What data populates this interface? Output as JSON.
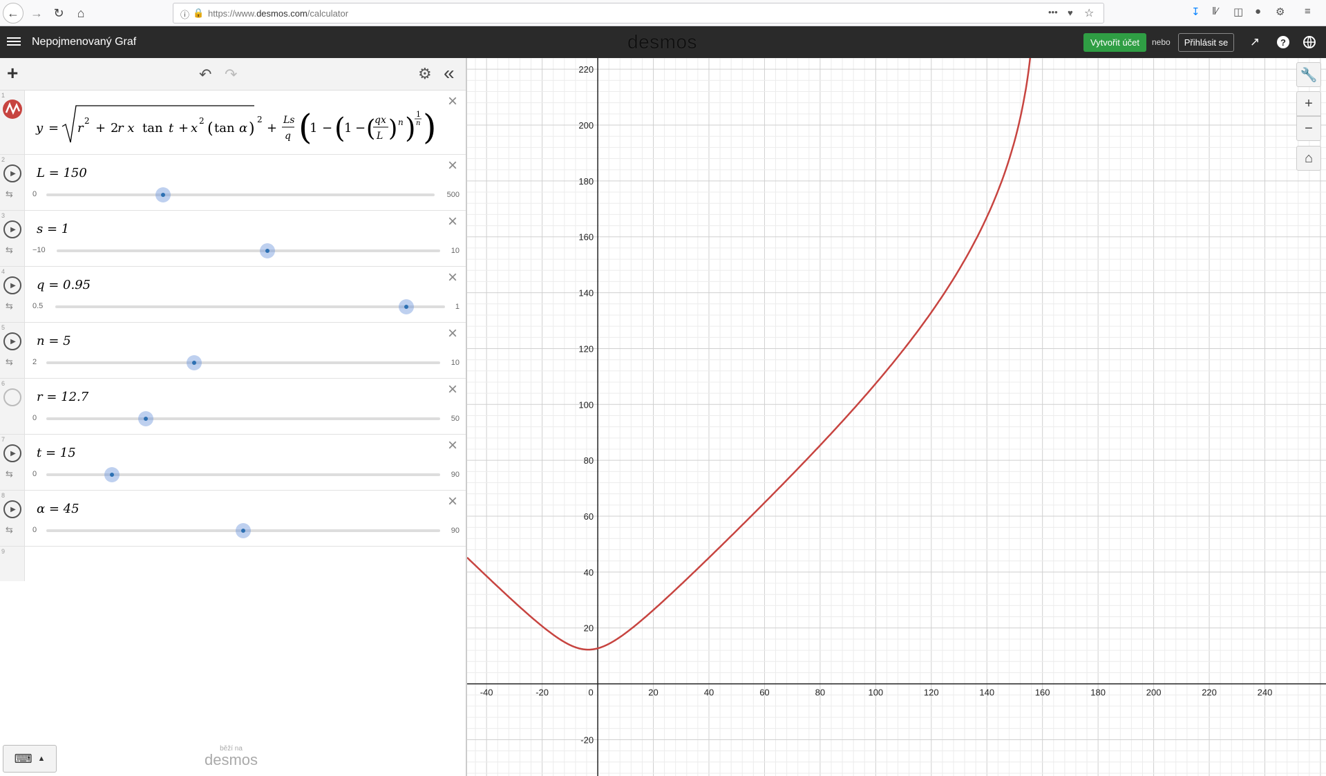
{
  "browser": {
    "url_prefix": "https://www.",
    "url_domain": "desmos.com",
    "url_path": "/calculator",
    "page_actions": "•••"
  },
  "header": {
    "title": "Nepojmenovaný Graf",
    "brand": "desmos",
    "create_account": "Vytvořit účet",
    "or": "nebo",
    "login": "Přihlásit se"
  },
  "expressions": [
    {
      "num": "1",
      "type": "formula",
      "latex": "y = √(r² + 2r x tan t + x²(tan α)²) + (Ls/q)(1 − (1 − (qx/L)ⁿ)^(1/n))",
      "color": "#c74440"
    },
    {
      "num": "2",
      "type": "slider",
      "label": "L = 150",
      "min": "0",
      "max": "500",
      "value": 150,
      "range": [
        0,
        500
      ]
    },
    {
      "num": "3",
      "type": "slider",
      "label": "s = 1",
      "min": "−10",
      "max": "10",
      "value": 1,
      "range": [
        -10,
        10
      ]
    },
    {
      "num": "4",
      "type": "slider",
      "label": "q = 0.95",
      "min": "0.5",
      "max": "1",
      "value": 0.95,
      "range": [
        0.5,
        1
      ]
    },
    {
      "num": "5",
      "type": "slider",
      "label": "n = 5",
      "min": "2",
      "max": "10",
      "value": 5,
      "range": [
        2,
        10
      ]
    },
    {
      "num": "6",
      "type": "slider",
      "label": "r = 12.7",
      "min": "0",
      "max": "50",
      "value": 12.7,
      "range": [
        0,
        50
      ],
      "hidden": true
    },
    {
      "num": "7",
      "type": "slider",
      "label": "t = 15",
      "min": "0",
      "max": "90",
      "value": 15,
      "range": [
        0,
        90
      ]
    },
    {
      "num": "8",
      "type": "slider",
      "label": "α = 45",
      "min": "0",
      "max": "90",
      "value": 45,
      "range": [
        0,
        90
      ]
    },
    {
      "num": "9",
      "type": "empty"
    }
  ],
  "footer": {
    "powered_by": "běží na",
    "powered_brand": "desmos"
  },
  "graph": {
    "x_ticks": [
      "-40",
      "-20",
      "0",
      "20",
      "40",
      "60",
      "80",
      "100",
      "120",
      "140",
      "160",
      "180",
      "200",
      "220",
      "240"
    ],
    "y_ticks": [
      "220",
      "200",
      "180",
      "160",
      "140",
      "120",
      "100",
      "80",
      "60",
      "40",
      "20",
      "-20"
    ],
    "x_range": [
      -47,
      262
    ],
    "y_range": [
      -33,
      224
    ],
    "curve_color": "#c74440"
  },
  "icons": {
    "back": "back-arrow-icon",
    "forward": "forward-arrow-icon",
    "reload": "reload-icon",
    "home": "home-icon",
    "wrench": "wrench-icon",
    "zoom_in": "zoom-in-icon",
    "zoom_out": "zoom-out-icon",
    "default_view": "home-icon"
  }
}
